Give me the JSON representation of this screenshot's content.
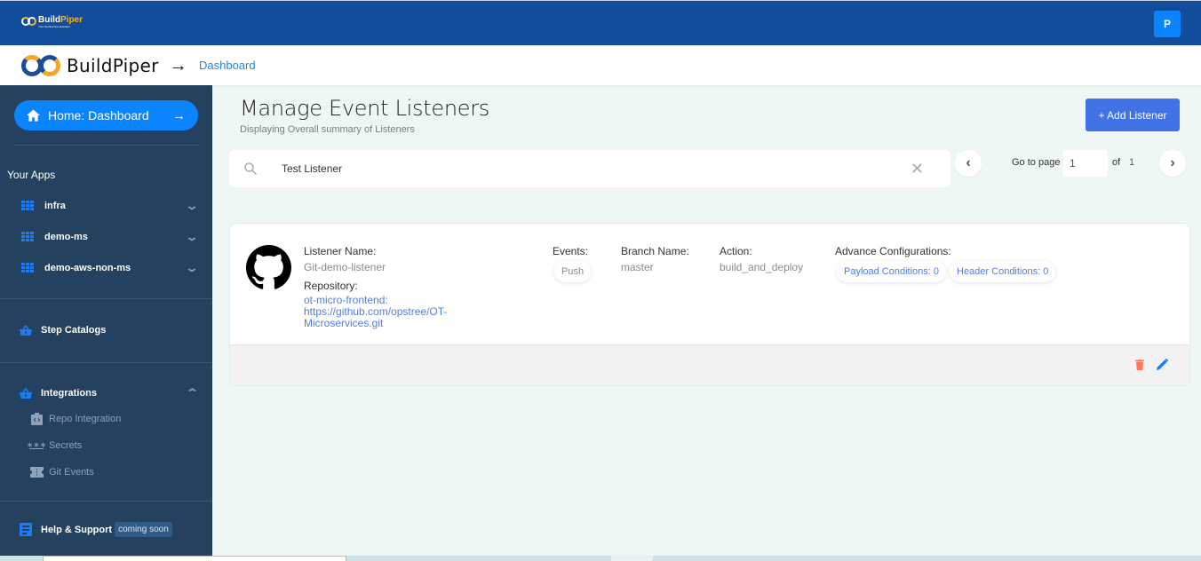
{
  "topbar": {
    "logo_brand_a": "Build",
    "logo_brand_b": "Piper",
    "logo_tagline": "Your DevSecOps assistant",
    "avatar_initial": "P"
  },
  "header": {
    "brand": "BuildPiper",
    "breadcrumb": "Dashboard"
  },
  "sidebar": {
    "home_label": "Home: Dashboard",
    "your_apps_label": "Your Apps",
    "apps": [
      {
        "label": "infra"
      },
      {
        "label": "demo-ms"
      },
      {
        "label": "demo-aws-non-ms"
      }
    ],
    "step_catalogs_label": "Step Catalogs",
    "integrations_label": "Integrations",
    "integrations_sub": [
      {
        "label": "Repo Integration"
      },
      {
        "label": "Secrets"
      },
      {
        "label": "Git Events"
      }
    ],
    "help_label": "Help & Support",
    "help_badge": "coming soon"
  },
  "main": {
    "title": "Manage Event Listeners",
    "subtitle": "Displaying Overall summary of Listeners",
    "add_button": "+ Add Listener",
    "search_value": "Test Listener",
    "pagination": {
      "goto_label": "Go to page",
      "current_page": "1",
      "of_label": "of",
      "total_pages": "1"
    },
    "listener": {
      "name_label": "Listener Name:",
      "name": "Git-demo-listener",
      "repo_label": "Repository:",
      "repo": "ot-micro-frontend: https://github.com/opstree/OT-Microservices.git",
      "events_label": "Events:",
      "event": "Push",
      "branch_label": "Branch Name:",
      "branch": "master",
      "action_label": "Action:",
      "action": "build_and_deploy",
      "advance_label": "Advance Configurations:",
      "payload_conditions": "Payload Conditions: 0",
      "header_conditions": "Header Conditions: 0"
    }
  },
  "colors": {
    "topbar": "#124d9b",
    "sidebar": "#244260",
    "accent": "#0a84ff",
    "add_button": "#4172e6",
    "link": "#4f7ee8",
    "delete": "#ff7b5c"
  }
}
